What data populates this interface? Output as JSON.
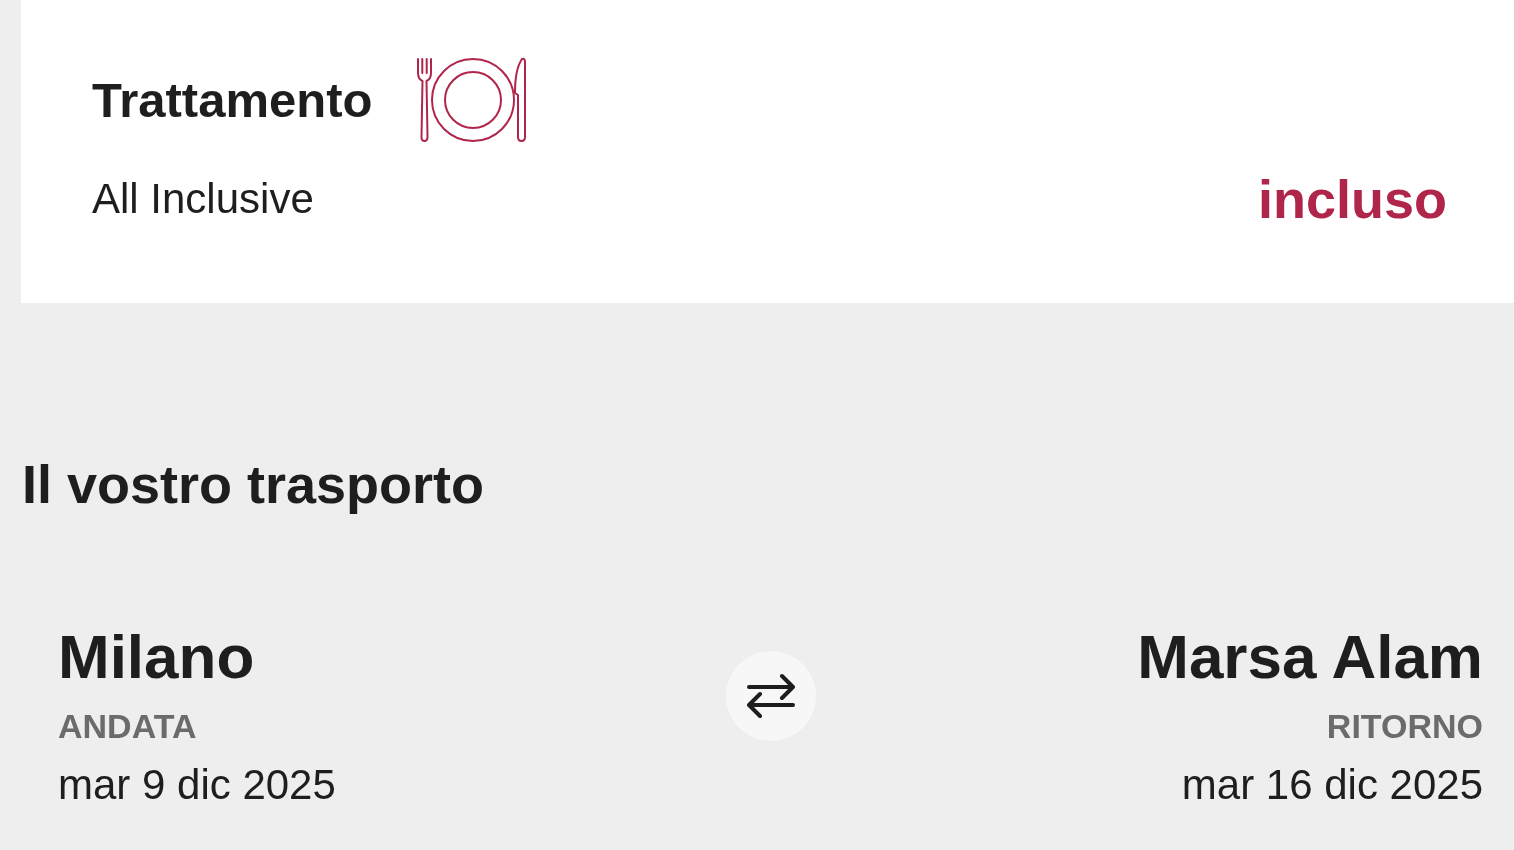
{
  "meal_plan": {
    "title": "Trattamento",
    "value": "All Inclusive",
    "price": "incluso"
  },
  "transport": {
    "title": "Il vostro trasporto",
    "legs": [
      {
        "kind": "outbound",
        "city": "Milano",
        "label": "ANDATA",
        "date": "mar 9 dic 2025"
      },
      {
        "kind": "return",
        "city": "Marsa Alam",
        "label": "RITORNO",
        "date": "mar 16 dic 2025"
      }
    ]
  }
}
